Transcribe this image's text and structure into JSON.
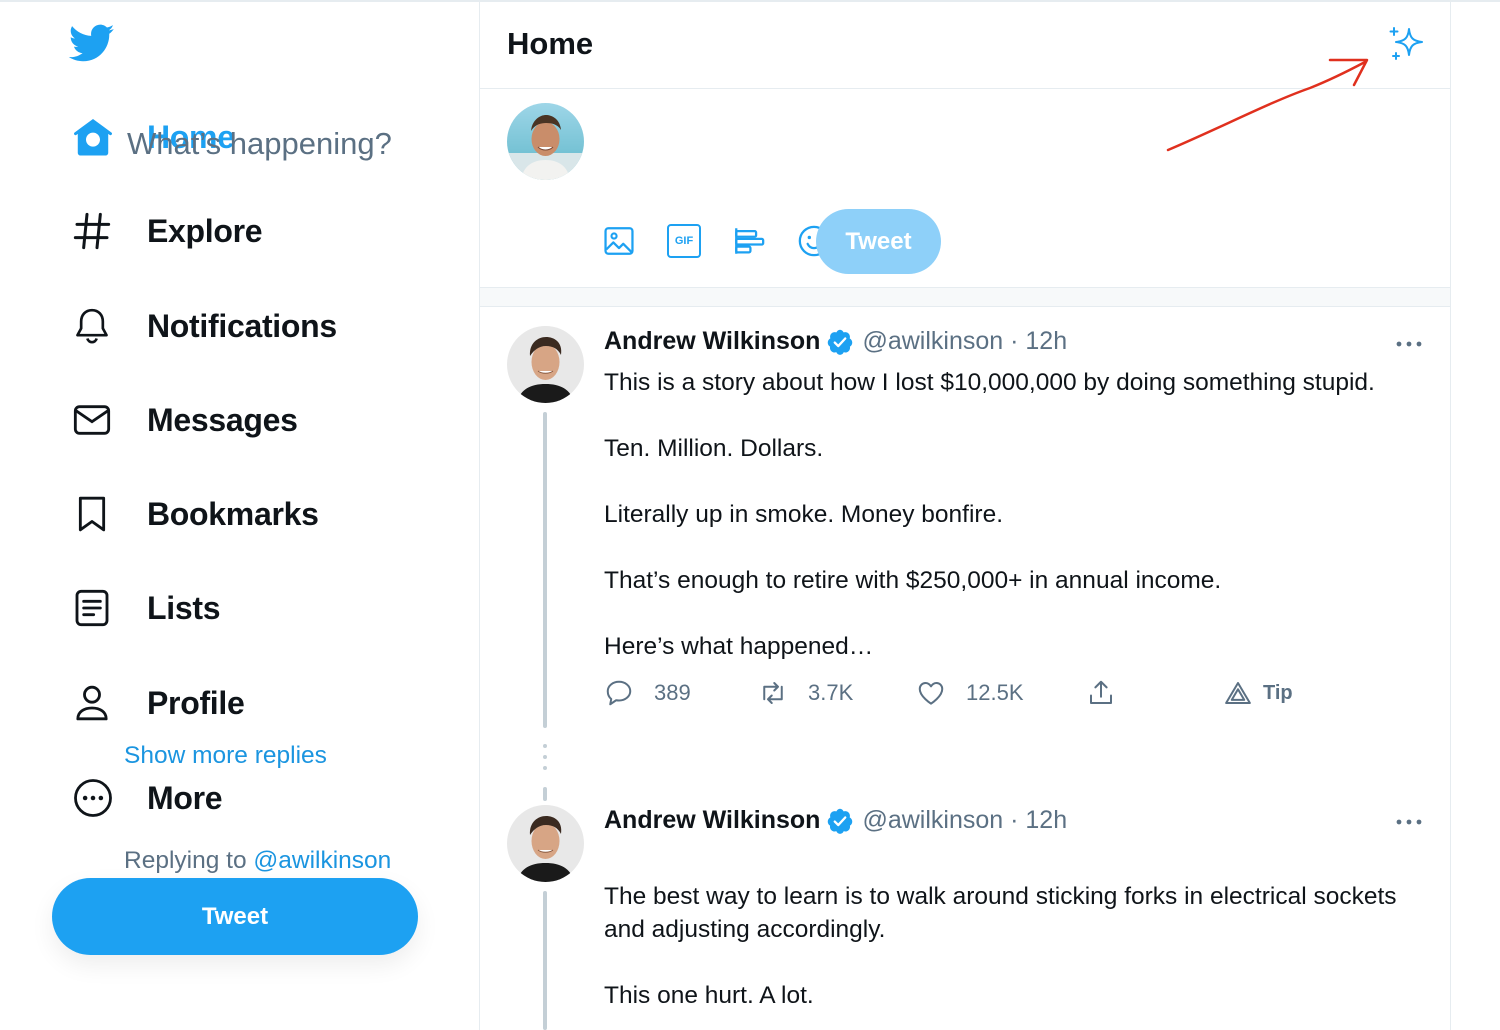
{
  "colors": {
    "accent": "#1da1f2",
    "text": "#0f1419",
    "muted": "#5b7083",
    "annotation": "#e0301e"
  },
  "sidebar": {
    "logo_icon": "twitter-bird-icon",
    "items": [
      {
        "label": "Home",
        "icon": "home-icon",
        "active": true
      },
      {
        "label": "Explore",
        "icon": "hashtag-icon"
      },
      {
        "label": "Notifications",
        "icon": "bell-icon"
      },
      {
        "label": "Messages",
        "icon": "envelope-icon"
      },
      {
        "label": "Bookmarks",
        "icon": "bookmark-icon"
      },
      {
        "label": "Lists",
        "icon": "list-icon"
      },
      {
        "label": "Profile",
        "icon": "person-icon"
      },
      {
        "label": "More",
        "icon": "more-circle-icon"
      }
    ],
    "tweet_button": "Tweet"
  },
  "header": {
    "title": "Home",
    "action_icon": "sparkle-icon"
  },
  "composer": {
    "placeholder": "What’s happening?",
    "tools": [
      "image-icon",
      "gif-icon",
      "poll-icon",
      "emoji-icon",
      "schedule-icon"
    ],
    "gif_label": "GIF",
    "tweet_button": "Tweet"
  },
  "tweets": [
    {
      "name": "Andrew Wilkinson",
      "handle": "@awilkinson · 12h",
      "text": "This is a story about how I lost $10,000,000 by doing something stupid.\n\nTen. Million. Dollars.\n\nLiterally up in smoke. Money bonfire.\n\nThat’s enough to retire with $250,000+ in annual income.\n\nHere’s what happened…",
      "actions": {
        "replies": "389",
        "retweets": "3.7K",
        "likes": "12.5K",
        "tip": "Tip"
      }
    },
    {
      "name": "Andrew Wilkinson",
      "handle": "@awilkinson · 12h",
      "replying_prefix": "Replying to",
      "replying_to": "@awilkinson",
      "text": "The best way to learn is to walk around sticking forks in electrical sockets and adjusting accordingly.\n\nThis one hurt. A lot."
    }
  ],
  "show_more_replies": "Show more replies"
}
